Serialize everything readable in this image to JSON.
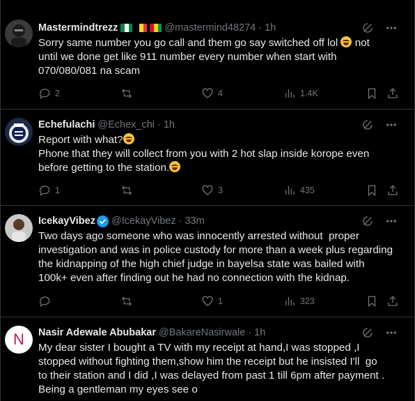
{
  "tweets": [
    {
      "name": "Mastermindtrezz",
      "handle": "@mastermind48274",
      "time": "· 1h",
      "lines": [
        "Sorry same number you go call and them go say switched off lol ",
        " not",
        "until we done get like 911 number every number when start with",
        "070/080/081 na scam"
      ],
      "replies": "2",
      "reposts": "",
      "likes": "4",
      "views": "1.4K"
    },
    {
      "name": "Echefulachi",
      "handle": "@Echex_chi",
      "time": "· 1h",
      "lines": [
        "Report with what?",
        "Phone that they will collect from you with 2 hot slap inside korope even",
        "before getting to the station."
      ],
      "replies": "1",
      "reposts": "",
      "likes": "3",
      "views": "435"
    },
    {
      "name": "IcekayVibez",
      "handle": "@IcekayVibez",
      "time": "· 33m",
      "lines": [
        "Two days ago someone who was innocently arrested without  proper",
        "investigation and was in police custody for more than a week plus regarding",
        "the kidnapping of the high chief judge in bayelsa state was bailed with",
        "100k+ even after finding out he had no connection with the kidnap."
      ],
      "replies": "",
      "reposts": "",
      "likes": "1",
      "views": "323"
    },
    {
      "name": "Nasir Adewale Abubakar",
      "handle": "@BakareNasirwale",
      "time": "· 1h",
      "avatar_letter": "N",
      "lines": [
        "My dear sister I bought a TV with my receipt at hand,I was stopped ,I",
        "stopped without fighting them,show him the receipt but he insisted I'll  go",
        "to their station and I did ,I was delayed from past 1 till 6pm after payment .",
        "Being a gentleman my eyes see o"
      ]
    }
  ],
  "colors": {
    "background": "#000000",
    "text": "#e7e9ea",
    "muted": "#71767b",
    "border": "#2f3336",
    "verified": "#1d9bf0",
    "avatar_n": "#c2185b"
  },
  "icons": [
    "grok-icon",
    "more-icon",
    "reply-icon",
    "repost-icon",
    "like-icon",
    "views-icon",
    "bookmark-icon",
    "share-icon"
  ]
}
